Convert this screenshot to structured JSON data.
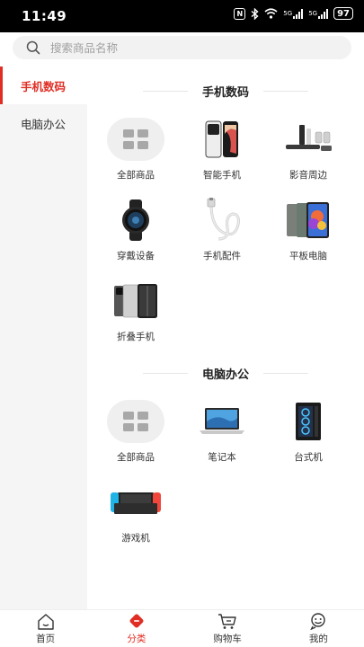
{
  "status_bar": {
    "time": "11:49",
    "nfc": "N",
    "network": "5G",
    "network2": "5G",
    "battery": "97"
  },
  "search": {
    "placeholder": "搜索商品名称"
  },
  "sidebar": {
    "items": [
      {
        "label": "手机数码",
        "active": true
      },
      {
        "label": "电脑办公",
        "active": false
      }
    ]
  },
  "sections": [
    {
      "title": "手机数码",
      "items": [
        {
          "label": "全部商品",
          "icon": "grid-icon"
        },
        {
          "label": "智能手机",
          "icon": "smartphone-icon"
        },
        {
          "label": "影音周边",
          "icon": "speaker-icon"
        },
        {
          "label": "穿戴设备",
          "icon": "smartwatch-icon"
        },
        {
          "label": "手机配件",
          "icon": "cable-icon"
        },
        {
          "label": "平板电脑",
          "icon": "tablet-icon"
        },
        {
          "label": "折叠手机",
          "icon": "foldable-phone-icon"
        }
      ]
    },
    {
      "title": "电脑办公",
      "items": [
        {
          "label": "全部商品",
          "icon": "grid-icon"
        },
        {
          "label": "笔记本",
          "icon": "laptop-icon"
        },
        {
          "label": "台式机",
          "icon": "desktop-tower-icon"
        },
        {
          "label": "游戏机",
          "icon": "game-console-icon"
        }
      ]
    }
  ],
  "bottom_nav": {
    "items": [
      {
        "label": "首页",
        "icon": "home-icon",
        "active": false
      },
      {
        "label": "分类",
        "icon": "category-icon",
        "active": true
      },
      {
        "label": "购物车",
        "icon": "cart-icon",
        "active": false
      },
      {
        "label": "我的",
        "icon": "profile-icon",
        "active": false
      }
    ]
  },
  "colors": {
    "accent": "#e02e24",
    "sidebar_bg": "#f5f5f5",
    "search_bg": "#f2f2f2"
  }
}
